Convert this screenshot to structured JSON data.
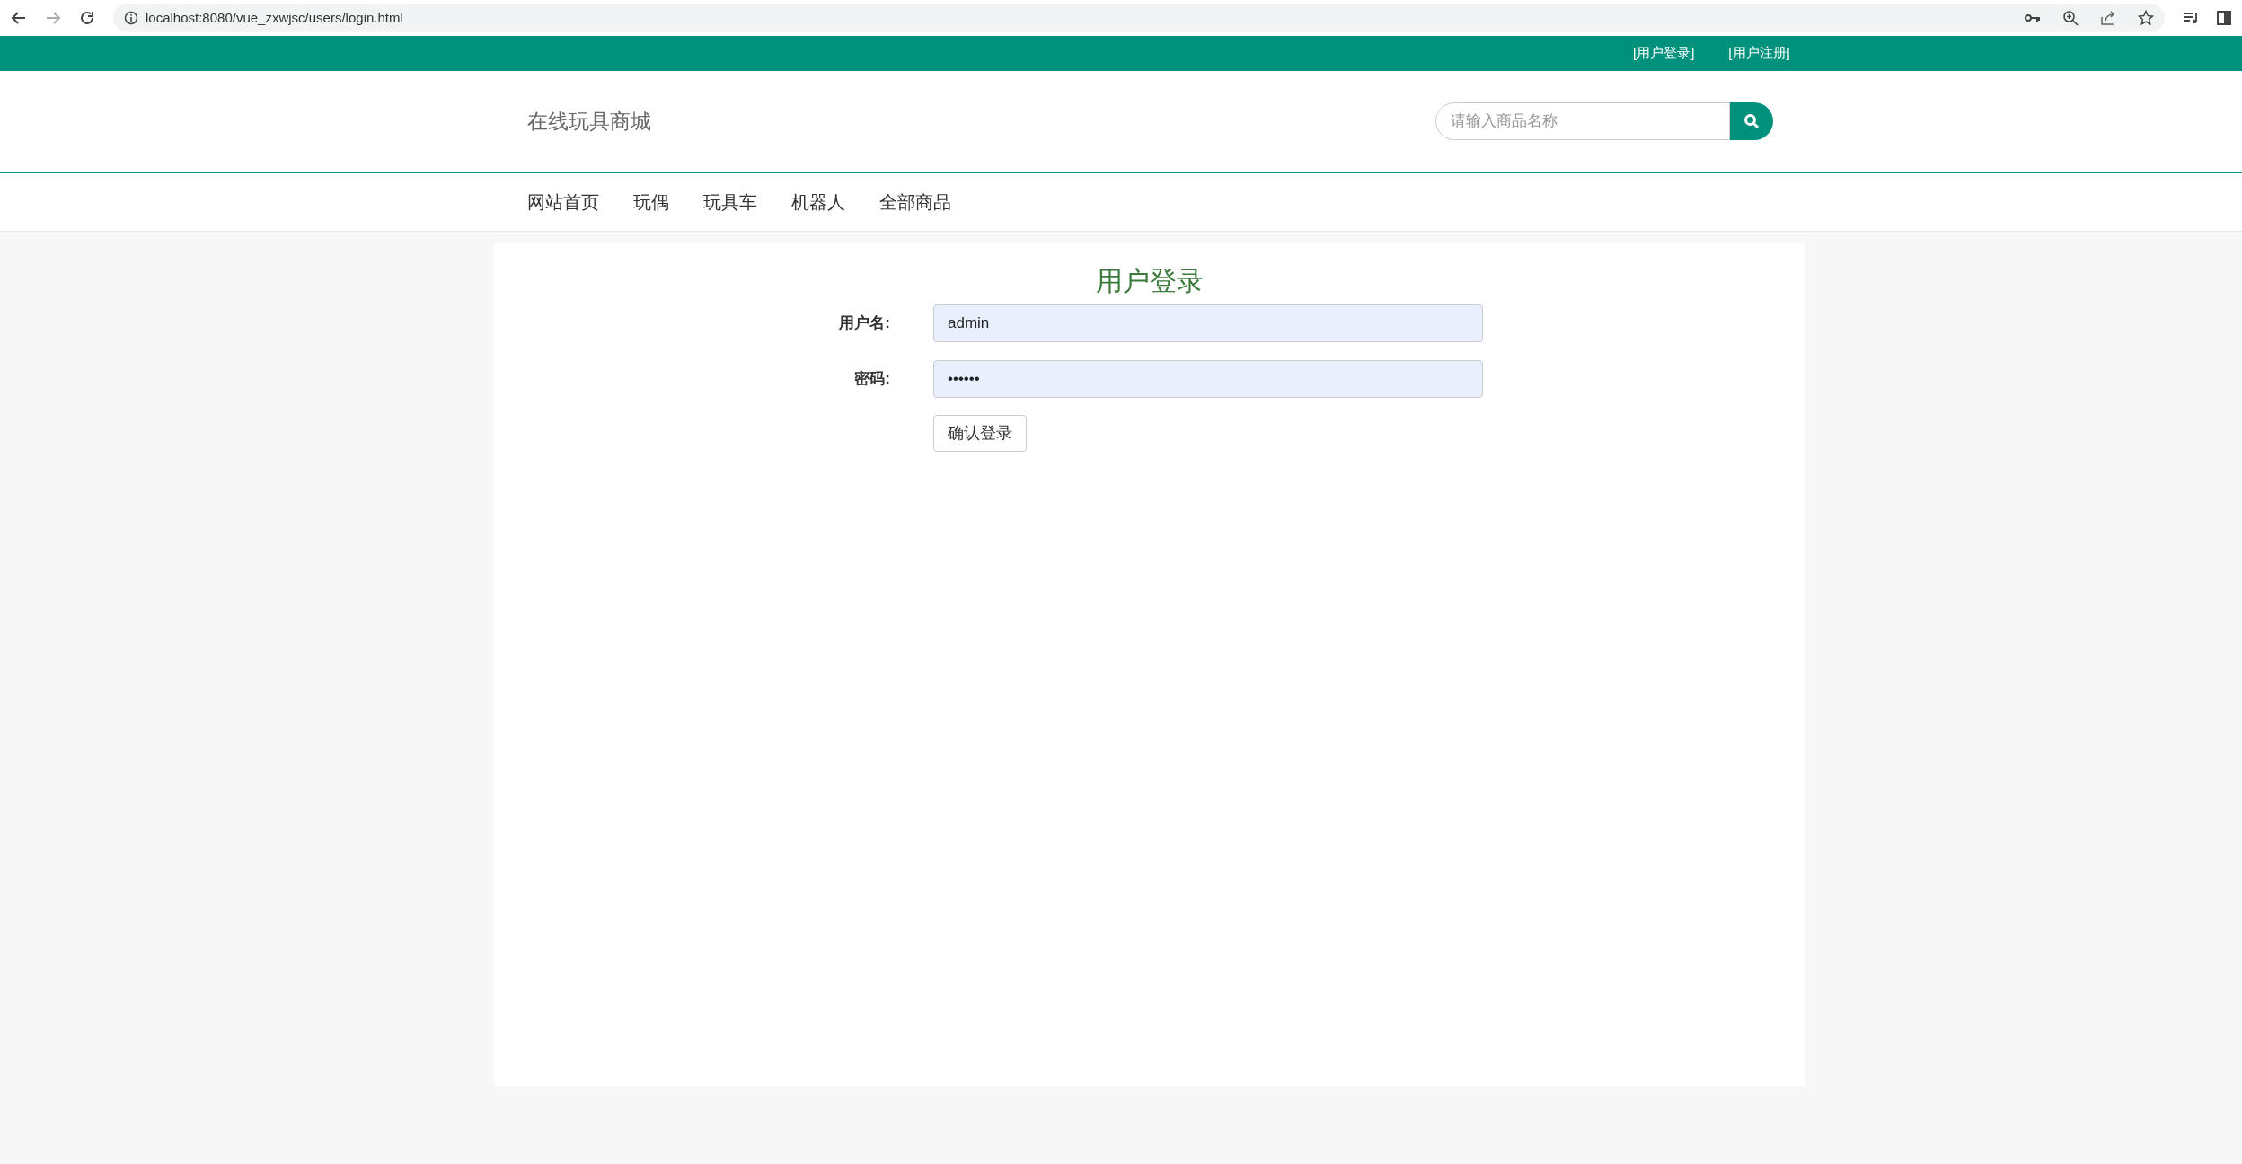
{
  "browser": {
    "url": "localhost:8080/vue_zxwjsc/users/login.html"
  },
  "top_bar": {
    "links": [
      "[用户登录]",
      "[用户注册]"
    ]
  },
  "header": {
    "logo": "在线玩具商城",
    "search": {
      "placeholder": "请输入商品名称"
    }
  },
  "nav": {
    "items": [
      "网站首页",
      "玩偶",
      "玩具车",
      "机器人",
      "全部商品"
    ]
  },
  "login": {
    "title": "用户登录",
    "fields": [
      {
        "label": "用户名:",
        "value": "admin"
      },
      {
        "label": "密码:",
        "value": "••••••"
      }
    ],
    "submit": "确认登录"
  }
}
